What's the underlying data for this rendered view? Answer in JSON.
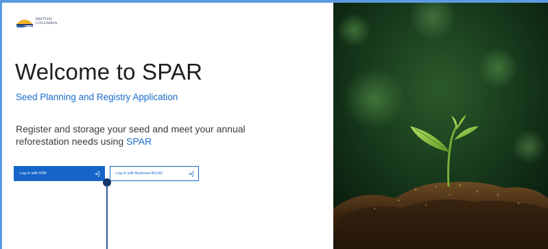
{
  "logo": {
    "line1": "BRITISH",
    "line2": "COLUMBIA"
  },
  "hero": {
    "title": "Welcome to SPAR",
    "subtitle": "Seed Planning and Registry Application",
    "description": "Register and storage your seed and meet your annual reforestation needs using",
    "description_link": "SPAR"
  },
  "buttons": {
    "idir_label": "Log in with IDIR",
    "bceid_label": "Log in with Business BCeID"
  },
  "icons": {
    "login": "login-icon",
    "logo": "bc-logo-icon"
  },
  "colors": {
    "accent": "#1565c8",
    "title": "#1e1e1e",
    "page_background": "#5b9be0"
  }
}
